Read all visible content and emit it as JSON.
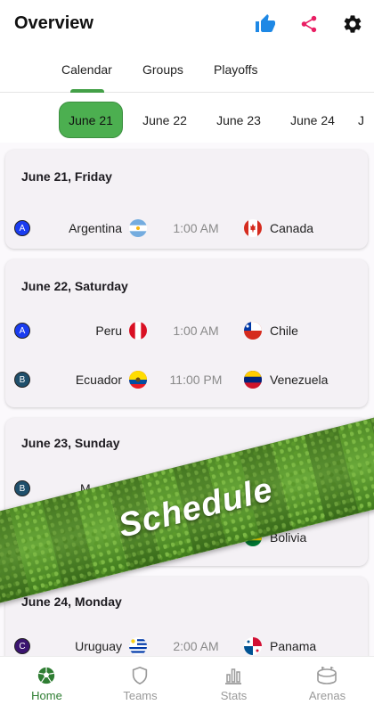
{
  "header": {
    "title": "Overview"
  },
  "tabs": [
    {
      "label": "Calendar"
    },
    {
      "label": "Groups"
    },
    {
      "label": "Playoffs"
    }
  ],
  "dates": [
    {
      "label": "June 21"
    },
    {
      "label": "June 22"
    },
    {
      "label": "June 23"
    },
    {
      "label": "June 24"
    },
    {
      "label": "J"
    }
  ],
  "days": [
    {
      "date": "June 21, Friday",
      "matches": [
        {
          "group": "A",
          "home": "Argentina",
          "time": "1:00 AM",
          "away": "Canada"
        }
      ]
    },
    {
      "date": "June 22, Saturday",
      "matches": [
        {
          "group": "A",
          "home": "Peru",
          "time": "1:00 AM",
          "away": "Chile"
        },
        {
          "group": "B",
          "home": "Ecuador",
          "time": "11:00 PM",
          "away": "Venezuela"
        }
      ]
    },
    {
      "date": "June 23, Sunday",
      "matches": [
        {
          "group": "B",
          "home": "M",
          "time": "",
          "away": ""
        },
        {
          "group": "",
          "home": "",
          "time": "",
          "away": "Bolivia"
        }
      ]
    },
    {
      "date": "June 24, Monday",
      "matches": [
        {
          "group": "C",
          "home": "Uruguay",
          "time": "2:00 AM",
          "away": "Panama"
        }
      ]
    }
  ],
  "banner": {
    "text": "Schedule"
  },
  "nav": [
    {
      "label": "Home"
    },
    {
      "label": "Teams"
    },
    {
      "label": "Stats"
    },
    {
      "label": "Arenas"
    }
  ],
  "colors": {
    "accent": "#4caf50",
    "group_a": "#1a3cf0",
    "group_b": "#1f4f6b",
    "group_c": "#3b1470",
    "like": "#1e88e5",
    "share": "#e91e63"
  }
}
